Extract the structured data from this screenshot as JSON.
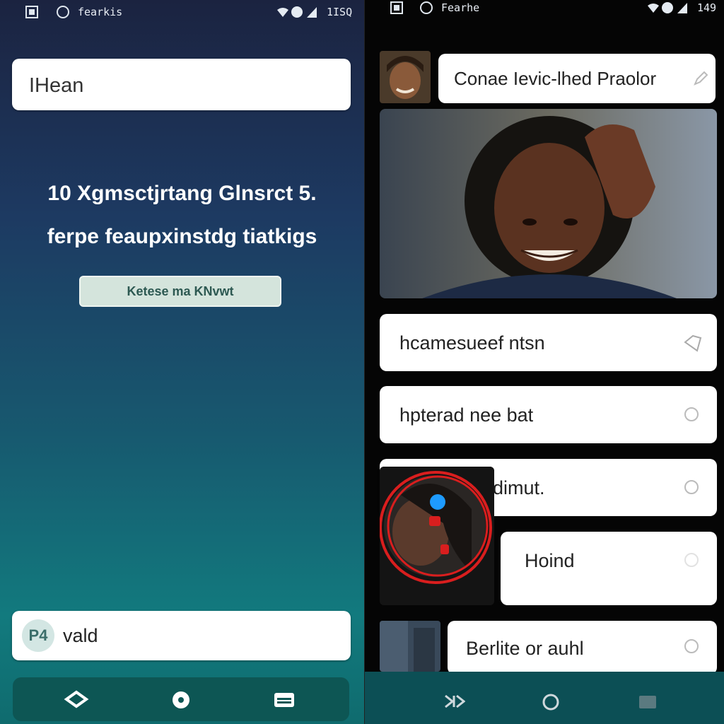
{
  "left": {
    "status": {
      "app_label": "fearkis",
      "time": "1ISQ"
    },
    "search_value": "IHean",
    "headline_line1": "10 Xgmsctjrtang Glnsrct 5.",
    "headline_line2": "ferpe feaupxinstdg tiatkigs",
    "cta_label": "Ketese ma KNvwt",
    "bottom_input": {
      "badge": "P4",
      "value": "vald"
    },
    "nav": [
      "back-icon",
      "home-icon",
      "menu-icon"
    ]
  },
  "right": {
    "status": {
      "app_label": "Fearhe",
      "time": "149"
    },
    "top_field": "Conae Ievic-lhed Praolor",
    "options": [
      {
        "label": "hcamesueef ntsn"
      },
      {
        "label": "hpterad nee bat"
      },
      {
        "label": "dimut."
      },
      {
        "label": "Hoind"
      },
      {
        "label": "Berlite or auhl"
      }
    ],
    "nav": [
      "recent-icon",
      "home-icon",
      "square-icon"
    ]
  },
  "colors": {
    "left_bg_top": "#1b2340",
    "left_bg_bottom": "#0f6b6e",
    "right_bg": "#050505",
    "accent_red": "#d91e1e",
    "accent_blue": "#1e9bff"
  }
}
